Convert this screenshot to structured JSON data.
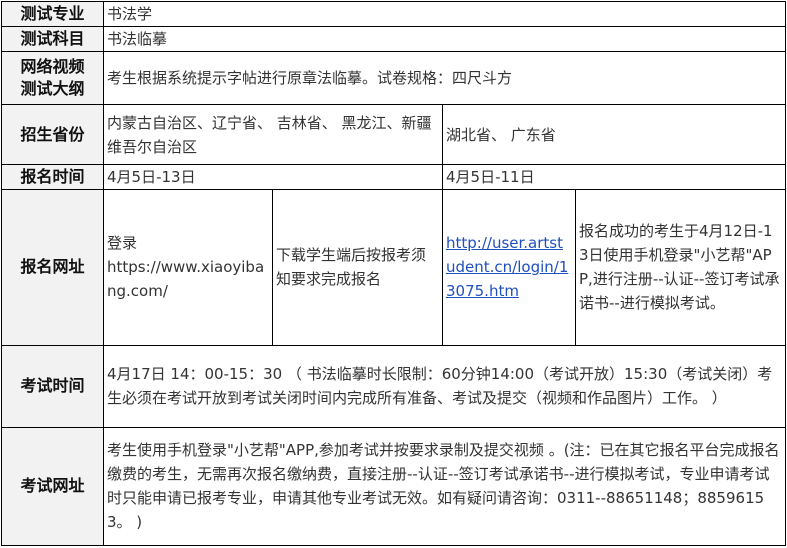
{
  "rows": {
    "major": {
      "label": "测试专业",
      "value": "书法学"
    },
    "subject": {
      "label": "测试科目",
      "value": "书法临摹"
    },
    "outline": {
      "label_line1": "网络视频",
      "label_line2": "测试大纲",
      "value": "考生根据系统提示字帖进行原章法临摹。试卷规格：四尺斗方"
    },
    "provinces": {
      "label": "招生省份",
      "group_a": "内蒙古自治区、辽宁省、 吉林省、 黑龙江、新疆维吾尔自治区",
      "group_b": "湖北省、 广东省"
    },
    "reg_time": {
      "label": "报名时间",
      "group_a": "4月5日-13日",
      "group_b": "4月5日-11日"
    },
    "reg_site": {
      "label": "报名网址",
      "a_site_title": "登录",
      "a_site_url": "https://www.xiaoyibang.com/",
      "a_instruction": "下载学生端后按报考须知要求完成报名",
      "b_site_url": "http://user.artstudent.cn/login/13075.htm",
      "b_instruction": "报名成功的考生于4月12日-13日使用手机登录\"小艺帮\"APP,进行注册--认证--签订考试承诺书--进行模拟考试。"
    },
    "exam_time": {
      "label": "考试时间",
      "value": "4月17日 14：00-15：30 （ 书法临摹时长限制：60分钟14:00（考试开放）15:30（考试关闭）考生必须在考试开放到考试关闭时间内完成所有准备、考试及提交（视频和作品图片）工作。 ）"
    },
    "exam_site": {
      "label": "考试网址",
      "value": "考生使用手机登录\"小艺帮\"APP,参加考试并按要求录制及提交视频 。(注：已在其它报名平台完成报名缴费的考生，无需再次报名缴纳费，直接注册--认证--签订考试承诺书--进行模拟考试，专业申请考试时只能申请已报考专业，申请其他专业考试无效。如有疑问请咨询：0311--88651148；88596153。 )"
    }
  }
}
